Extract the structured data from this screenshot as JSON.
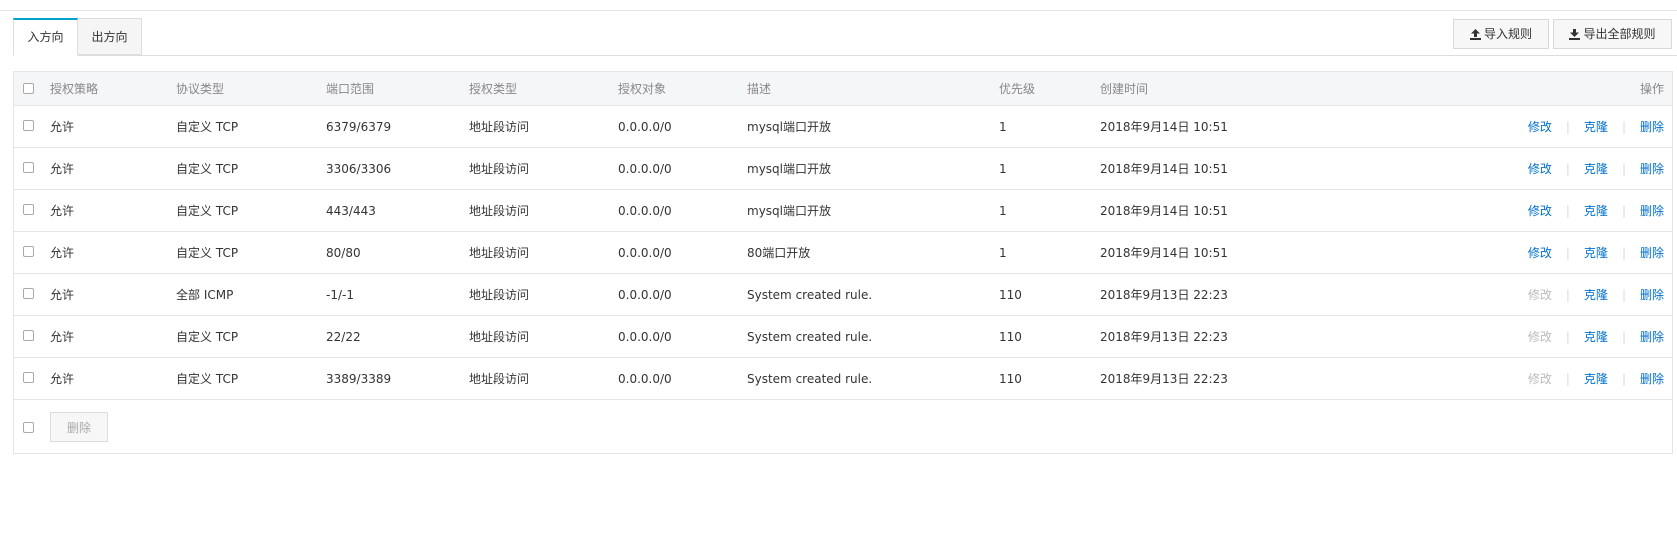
{
  "tabs": [
    {
      "label": "入方向",
      "active": true
    },
    {
      "label": "出方向",
      "active": false
    }
  ],
  "toolbar": {
    "import_label": "导入规则",
    "export_label": "导出全部规则"
  },
  "table": {
    "headers": {
      "policy": "授权策略",
      "protocol": "协议类型",
      "port_range": "端口范围",
      "auth_type": "授权类型",
      "auth_target": "授权对象",
      "description": "描述",
      "priority": "优先级",
      "created": "创建时间",
      "actions": "操作"
    },
    "rows": [
      {
        "policy": "允许",
        "protocol": "自定义 TCP",
        "port_range": "6379/6379",
        "auth_type": "地址段访问",
        "auth_target": "0.0.0.0/0",
        "description": "mysql端口开放",
        "priority": "1",
        "created": "2018年9月14日 10:51",
        "edit": "修改",
        "clone": "克隆",
        "delete": "删除",
        "edit_enabled": true
      },
      {
        "policy": "允许",
        "protocol": "自定义 TCP",
        "port_range": "3306/3306",
        "auth_type": "地址段访问",
        "auth_target": "0.0.0.0/0",
        "description": "mysql端口开放",
        "priority": "1",
        "created": "2018年9月14日 10:51",
        "edit": "修改",
        "clone": "克隆",
        "delete": "删除",
        "edit_enabled": true
      },
      {
        "policy": "允许",
        "protocol": "自定义 TCP",
        "port_range": "443/443",
        "auth_type": "地址段访问",
        "auth_target": "0.0.0.0/0",
        "description": "mysql端口开放",
        "priority": "1",
        "created": "2018年9月14日 10:51",
        "edit": "修改",
        "clone": "克隆",
        "delete": "删除",
        "edit_enabled": true
      },
      {
        "policy": "允许",
        "protocol": "自定义 TCP",
        "port_range": "80/80",
        "auth_type": "地址段访问",
        "auth_target": "0.0.0.0/0",
        "description": "80端口开放",
        "priority": "1",
        "created": "2018年9月14日 10:51",
        "edit": "修改",
        "clone": "克隆",
        "delete": "删除",
        "edit_enabled": true
      },
      {
        "policy": "允许",
        "protocol": "全部 ICMP",
        "port_range": "-1/-1",
        "auth_type": "地址段访问",
        "auth_target": "0.0.0.0/0",
        "description": "System created rule.",
        "priority": "110",
        "created": "2018年9月13日 22:23",
        "edit": "修改",
        "clone": "克隆",
        "delete": "删除",
        "edit_enabled": false
      },
      {
        "policy": "允许",
        "protocol": "自定义 TCP",
        "port_range": "22/22",
        "auth_type": "地址段访问",
        "auth_target": "0.0.0.0/0",
        "description": "System created rule.",
        "priority": "110",
        "created": "2018年9月13日 22:23",
        "edit": "修改",
        "clone": "克隆",
        "delete": "删除",
        "edit_enabled": false
      },
      {
        "policy": "允许",
        "protocol": "自定义 TCP",
        "port_range": "3389/3389",
        "auth_type": "地址段访问",
        "auth_target": "0.0.0.0/0",
        "description": "System created rule.",
        "priority": "110",
        "created": "2018年9月13日 22:23",
        "edit": "修改",
        "clone": "克隆",
        "delete": "删除",
        "edit_enabled": false
      }
    ]
  },
  "footer": {
    "delete_label": "删除"
  },
  "colors": {
    "accent": "#00a2ca",
    "link": "#0070cc",
    "disabled_link": "#bbbbbb"
  }
}
